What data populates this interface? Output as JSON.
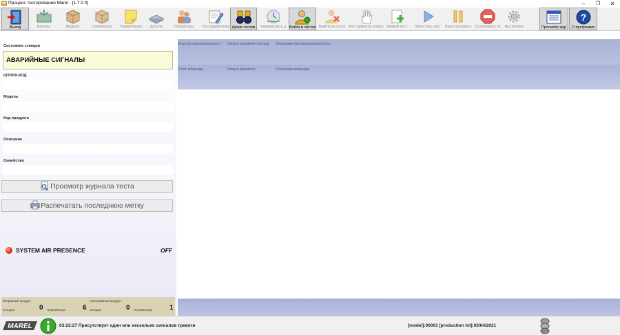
{
  "window": {
    "title": "Процесс тестирования Marel - [1.7.0.0]",
    "controls": {
      "minimize": "–",
      "maximize": "❐",
      "close": "✕"
    }
  },
  "toolbar": [
    {
      "id": "exit",
      "label": "Выход",
      "icon": "exit-door-icon",
      "state": "pressed"
    },
    {
      "id": "channels",
      "label": "Каналы",
      "icon": "channels-icon",
      "state": "dim"
    },
    {
      "id": "models",
      "label": "Модели",
      "icon": "models-box-icon",
      "state": "dim"
    },
    {
      "id": "families",
      "label": "Семейства",
      "icon": "families-box-icon",
      "state": "dim"
    },
    {
      "id": "notes",
      "label": "Примечания",
      "icon": "sticky-note-icon",
      "state": "dim"
    },
    {
      "id": "parts",
      "label": "Детали",
      "icon": "parts-icon",
      "state": "dim"
    },
    {
      "id": "operators",
      "label": "Операторы",
      "icon": "operators-icon",
      "state": "dim"
    },
    {
      "id": "sequences",
      "label": "Последовательн",
      "icon": "sequence-edit-icon",
      "state": "dim"
    },
    {
      "id": "archive",
      "label": "Архив тестов",
      "icon": "archive-binoculars-icon",
      "state": "pressed"
    },
    {
      "id": "change",
      "label": "перечислить д",
      "icon": "clock-change-icon",
      "state": "dim"
    },
    {
      "id": "login",
      "label": "Войти в систем",
      "icon": "login-user-icon",
      "state": "pressed"
    },
    {
      "id": "logout",
      "label": "Выйти из систе",
      "icon": "logout-user-icon",
      "state": "dim"
    },
    {
      "id": "operator_tools",
      "label": "Инструменты опера",
      "icon": "hand-icon",
      "state": "dim"
    },
    {
      "id": "new_test",
      "label": "Новый тест",
      "icon": "new-test-icon",
      "state": "dim"
    },
    {
      "id": "start_test",
      "label": "Запустить тест",
      "icon": "play-icon",
      "state": "dim"
    },
    {
      "id": "pause",
      "label": "Приостановить",
      "icon": "pause-icon",
      "state": "dim"
    },
    {
      "id": "stop",
      "label": "Остановить те",
      "icon": "stop-icon",
      "state": "dim"
    },
    {
      "id": "settings",
      "label": "Настройка",
      "icon": "gear-icon",
      "state": "dim"
    },
    {
      "id": "log_view",
      "label": "Просмотр жур",
      "icon": "log-window-icon",
      "state": "pressed"
    },
    {
      "id": "about",
      "label": "О программе",
      "icon": "help-icon",
      "state": "pressed"
    }
  ],
  "left_panel": {
    "station_state_label": "Состояние станции",
    "station_state_value": "АВАРИЙНЫЕ СИГНАЛЫ",
    "barcode_label": "ШТРИХ-КОД",
    "barcode_value": "",
    "model_label": "Модель",
    "model_value": "",
    "product_code_label": "Код продукта",
    "product_code_value": "",
    "description_label": "Описание",
    "description_value": "",
    "family_label": "Семейство",
    "family_value": "",
    "view_log_button": "Просмотр журнала теста",
    "print_label_button": "Распечатать последнюю метку",
    "air_presence_label": "SYSTEM AIR PRESENCE",
    "air_presence_state": "OFF",
    "counters": {
      "good_label": "Исправный продукт",
      "bad_label": "Неисправный продукт",
      "today_label": "Сегодня",
      "shift_label": "Переменную",
      "good_today": "0",
      "good_shift": "6",
      "bad_today": "0",
      "bad_shift": "1"
    }
  },
  "right_panel": {
    "sequence_headers": [
      "Код последовательност",
      "Запуск времени послед",
      "Описание последовательности"
    ],
    "command_headers": [
      "Счет команды",
      "Запуск времени",
      "Описание команды"
    ]
  },
  "status_bar": {
    "logo_text": "MAREL",
    "message": "03:22:27 Присутствует один или несколько сигналов тревоги",
    "model_info": "[model]:00001 [production lot]:03/04/2021"
  },
  "colors": {
    "alarm_bg": "#fafad8",
    "header_blue": "#a9b3d6",
    "counter_bg": "#d9d3b4",
    "status_red": "#d02000",
    "info_green": "#3aa82a"
  }
}
